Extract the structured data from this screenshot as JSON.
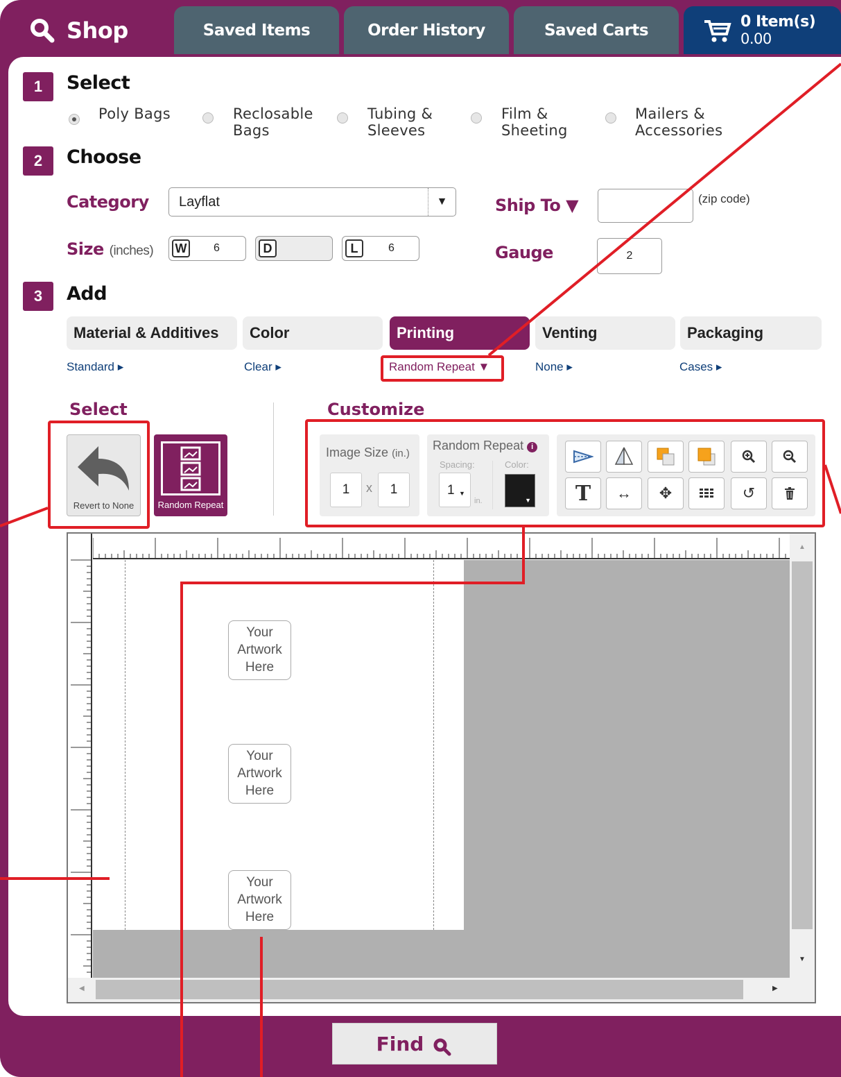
{
  "tabs": {
    "shop": "Shop",
    "saved_items": "Saved Items",
    "order_history": "Order History",
    "saved_carts": "Saved Carts",
    "cart_count": "0 Item(s)",
    "cart_total": "0.00"
  },
  "step1": {
    "number": "1",
    "title": "Select",
    "options": [
      {
        "line1": "Poly Bags",
        "line2": "",
        "selected": true
      },
      {
        "line1": "Reclosable",
        "line2": "Bags",
        "selected": false
      },
      {
        "line1": "Tubing &",
        "line2": "Sleeves",
        "selected": false
      },
      {
        "line1": "Film &",
        "line2": "Sheeting",
        "selected": false
      },
      {
        "line1": "Mailers &",
        "line2": "Accessories",
        "selected": false
      }
    ]
  },
  "step2": {
    "number": "2",
    "title": "Choose",
    "category_label": "Category",
    "category_value": "Layflat",
    "ship_to_label": "Ship To ▼",
    "zip_hint": "(zip code)",
    "size_label": "Size",
    "size_units": "(inches)",
    "w_key": "W",
    "w_value": "6",
    "d_key": "D",
    "d_value": "",
    "l_key": "L",
    "l_value": "6",
    "gauge_label": "Gauge",
    "gauge_value": "2"
  },
  "step3": {
    "number": "3",
    "title": "Add",
    "tabs": [
      {
        "label": "Material & Additives",
        "sub": "Standard ▸"
      },
      {
        "label": "Color",
        "sub": "Clear ▸"
      },
      {
        "label": "Printing",
        "sub": "Random Repeat ▼"
      },
      {
        "label": "Venting",
        "sub": "None ▸"
      },
      {
        "label": "Packaging",
        "sub": "Cases ▸"
      }
    ]
  },
  "select_section": {
    "title": "Select",
    "revert_label": "Revert to None",
    "random_label": "Random Repeat"
  },
  "customize": {
    "title": "Customize",
    "image_size_label": "Image Size",
    "image_size_units": "(in.)",
    "image_w": "1",
    "image_x": "x",
    "image_h": "1",
    "random_repeat_label": "Random Repeat",
    "spacing_label": "Spacing:",
    "spacing_value": "1",
    "spacing_units": "in.",
    "color_label": "Color:",
    "color_value": "#1a1a1a"
  },
  "canvas": {
    "artwork_lines": [
      "Your",
      "Artwork",
      "Here"
    ]
  },
  "find_button": "Find",
  "colors": {
    "brand": "#80205f",
    "tab_gray": "#4e6470",
    "cart_blue": "#0f3f79",
    "annotation_red": "#e01e26"
  }
}
